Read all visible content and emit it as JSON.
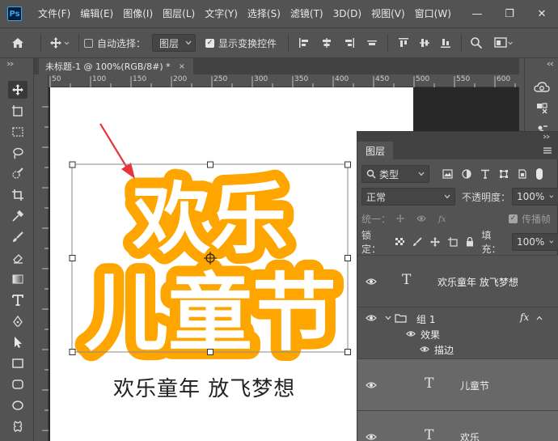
{
  "menu": {
    "logo": "Ps",
    "items": [
      "文件(F)",
      "编辑(E)",
      "图像(I)",
      "图层(L)",
      "文字(Y)",
      "选择(S)",
      "滤镜(T)",
      "3D(D)",
      "视图(V)",
      "窗口(W)"
    ]
  },
  "window_controls": {
    "minimize": "—",
    "restore": "❐",
    "close": "✕"
  },
  "options": {
    "auto_select_label": "自动选择：",
    "auto_select_target": "图层",
    "show_transform_label": "显示变换控件"
  },
  "document": {
    "tab_title": "未标题-1 @ 100%(RGB/8#) *",
    "close_glyph": "×",
    "ruler_numbers": [
      "50",
      "100",
      "150",
      "200",
      "250",
      "300",
      "350",
      "400",
      "450",
      "500",
      "550",
      "600"
    ],
    "headline_line1": "欢乐",
    "headline_line2": "儿童节",
    "caption": "欢乐童年 放飞梦想",
    "colors": {
      "headline_fill": "#ffffff",
      "headline_outline": "#ffa500",
      "arrow": "#e8343a"
    }
  },
  "layers_panel": {
    "tab": "图层",
    "filter_kind": "类型",
    "blend_mode": "正常",
    "opacity_label": "不透明度：",
    "opacity_value": "100%",
    "unify_label": "统一：",
    "propagate_label": "传播帧",
    "lock_label": "锁定：",
    "fill_label": "填充：",
    "fill_value": "100%",
    "layers": [
      {
        "name": "欢乐童年 放飞梦想",
        "type": "text"
      },
      {
        "name": "组 1",
        "type": "group",
        "fx": "fx",
        "effects_label": "效果",
        "effect_name": "描边"
      },
      {
        "name": "儿童节",
        "type": "text"
      },
      {
        "name": "欢乐",
        "type": "text"
      }
    ]
  }
}
